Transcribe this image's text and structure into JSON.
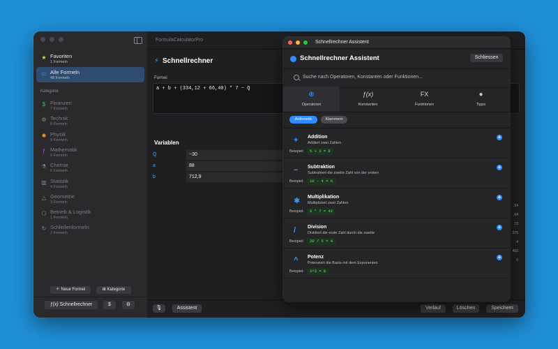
{
  "app": {
    "title": "FormulaCalculatorPro"
  },
  "sidebar": {
    "items": [
      {
        "title": "Favoriten",
        "sub": "1 Formeln",
        "icon": "star-icon",
        "glyph": "★",
        "color": "#f7d13a"
      },
      {
        "title": "Alle Formeln",
        "sub": "48 Formeln",
        "icon": "folder-icon",
        "glyph": "▭",
        "color": "#3a9bff"
      }
    ],
    "section": "Kategorie",
    "categories": [
      {
        "title": "Finanzen",
        "sub": "7 Formeln",
        "icon": "dollar-circle-icon",
        "glyph": "$",
        "color": "#3cc45a"
      },
      {
        "title": "Technik",
        "sub": "8 Formeln",
        "icon": "gear-icon",
        "glyph": "⚙",
        "color": "#8a8a8e"
      },
      {
        "title": "Physik",
        "sub": "9 Formeln",
        "icon": "atom-icon",
        "glyph": "✺",
        "color": "#f0a030"
      },
      {
        "title": "Mathematik",
        "sub": "9 Formeln",
        "icon": "function-icon",
        "glyph": "ƒ",
        "color": "#b45ad8"
      },
      {
        "title": "Chemie",
        "sub": "6 Formeln",
        "icon": "flask-icon",
        "glyph": "⚗",
        "color": "#8a8a8e"
      },
      {
        "title": "Statistik",
        "sub": "4 Formeln",
        "icon": "bar-chart-icon",
        "glyph": "▥",
        "color": "#8a8a8e"
      },
      {
        "title": "Geometrie",
        "sub": "3 Formeln",
        "icon": "triangle-icon",
        "glyph": "△",
        "color": "#8a8a8e"
      },
      {
        "title": "Betrieb & Logistik",
        "sub": "1 Formeln",
        "icon": "box-icon",
        "glyph": "⬡",
        "color": "#8a8a8e"
      },
      {
        "title": "Schleifenformeln",
        "sub": "2 Formeln",
        "icon": "loop-icon",
        "glyph": "↻",
        "color": "#8a8a8e"
      }
    ],
    "new_formula": "Neue Formel",
    "new_category": "Kategorie",
    "footer_tab": "Schnellrechner"
  },
  "main": {
    "title": "Schnellrechner",
    "formula_label": "Formel",
    "formula": "a + b + (334,12 + 66,40) * 7 − Q",
    "variables_title": "Variablen",
    "variables": [
      {
        "name": "Q",
        "value": "−30"
      },
      {
        "name": "a",
        "value": "88"
      },
      {
        "name": "b",
        "value": "712,9"
      }
    ],
    "right_edge": [
      ".54",
      ".64",
      ".73",
      "375",
      ".4",
      "460",
      "0"
    ],
    "bottom": {
      "assistant": "Assistent",
      "history": "Verlauf",
      "clear": "Löschen",
      "save": "Speichern"
    }
  },
  "assistant": {
    "window_title": "Schnellrechner Assistent",
    "title": "Schnellrechner Assistent",
    "close": "Schliessen",
    "search_placeholder": "Suche nach Operatoren, Konstanten oder Funktionen...",
    "tabs": [
      {
        "label": "Operatoren",
        "icon": "plus-minus-circle-icon",
        "glyph": "±"
      },
      {
        "label": "Konstanten",
        "icon": "fx-italic-icon",
        "glyph": "ƒ(x)"
      },
      {
        "label": "Funktionen",
        "icon": "fx-icon",
        "glyph": "FX"
      },
      {
        "label": "Tipps",
        "icon": "lightbulb-icon",
        "glyph": "💡"
      }
    ],
    "chips": [
      "Arithmetik",
      "Klammern"
    ],
    "example_label": "Beispiel:",
    "operators": [
      {
        "symbol": "+",
        "name": "Addition",
        "desc": "Addiert zwei Zahlen",
        "example": "5 + 3 = 8"
      },
      {
        "symbol": "−",
        "name": "Subtraktion",
        "desc": "Subtrahiert die zweite Zahl von der ersten",
        "example": "10 − 4 = 6"
      },
      {
        "symbol": "✱",
        "name": "Multiplikation",
        "desc": "Multipliziert zwei Zahlen",
        "example": "6 * 7 = 42"
      },
      {
        "symbol": "/",
        "name": "Division",
        "desc": "Dividiert die erste Zahl durch die zweite",
        "example": "20 / 5 = 4"
      },
      {
        "symbol": "^",
        "name": "Potenz",
        "desc": "Potenziert die Basis mit dem Exponenten",
        "example": "2^3 = 8"
      }
    ]
  },
  "colors": {
    "accent": "#2f8cff",
    "background": "#1f8fd6"
  }
}
